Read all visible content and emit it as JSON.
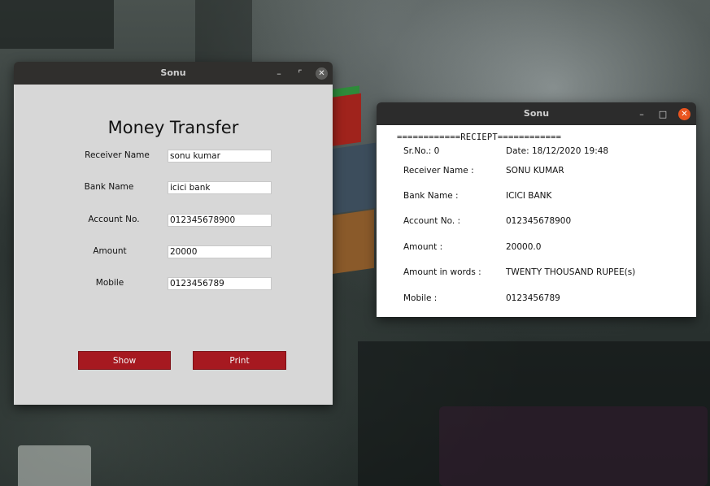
{
  "transfer_window": {
    "title": "Sonu",
    "controls": {
      "minimize": "–",
      "maximize": "⌜",
      "close": "✕"
    },
    "heading": "Money Transfer",
    "fields": [
      {
        "label": "Receiver Name",
        "value": "sonu kumar"
      },
      {
        "label": "Bank Name",
        "value": "icici bank"
      },
      {
        "label": "Account No.",
        "value": "012345678900"
      },
      {
        "label": "Amount",
        "value": "20000"
      },
      {
        "label": "Mobile",
        "value": "0123456789"
      }
    ],
    "buttons": {
      "show": "Show",
      "print": "Print"
    },
    "button_color": "#a61920",
    "background_color": "#d7d7d7"
  },
  "receipt_window": {
    "title": "Sonu",
    "controls": {
      "minimize": "–",
      "maximize": "□",
      "close": "✕"
    },
    "close_color": "#e9541f",
    "header": "============RECIEPT============",
    "serial": "Sr.No.: 0",
    "date": "Date: 18/12/2020 19:48",
    "rows": [
      {
        "label": "Receiver Name :",
        "value": "SONU KUMAR"
      },
      {
        "label": "Bank Name :",
        "value": "ICICI BANK"
      },
      {
        "label": "Account No. :",
        "value": "012345678900"
      },
      {
        "label": "Amount :",
        "value": "20000.0"
      },
      {
        "label": "Amount in words :",
        "value": "TWENTY THOUSAND RUPEE(s)"
      },
      {
        "label": "Mobile :",
        "value": "0123456789"
      }
    ]
  }
}
